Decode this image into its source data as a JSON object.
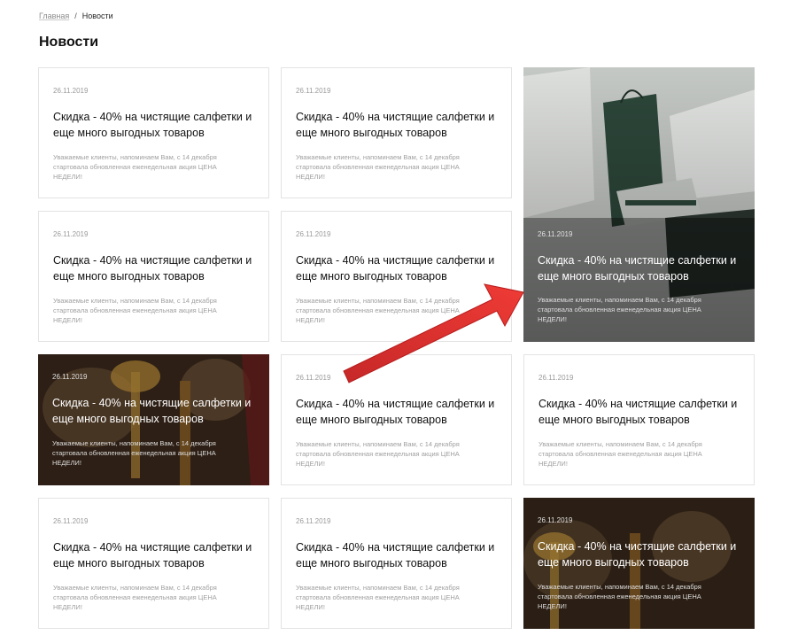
{
  "breadcrumb": {
    "home": "Главная",
    "separator": "/",
    "current": "Новости"
  },
  "page": {
    "title": "Новости"
  },
  "news": [
    {
      "date": "26.11.2019",
      "title": "Скидка - 40% на чистящие салфетки  и еще много выгодных товаров",
      "desc": "Уважаемые клиенты, напоминаем Вам, с 14 декабря стартовала обновленная еженедельная акция ЦЕНА НЕДЕЛИ!"
    },
    {
      "date": "26.11.2019",
      "title": "Скидка - 40% на чистящие салфетки  и еще много выгодных товаров",
      "desc": "Уважаемые клиенты, напоминаем Вам, с 14 декабря стартовала обновленная еженедельная акция ЦЕНА НЕДЕЛИ!"
    },
    {
      "date": "26.11.2019",
      "title": "Скидка - 40% на чистящие салфетки  и еще много выгодных товаров",
      "desc": "Уважаемые клиенты, напоминаем Вам, с 14 декабря стартовала обновленная еженедельная акция ЦЕНА НЕДЕЛИ!"
    },
    {
      "date": "26.11.2019",
      "title": "Скидка - 40% на чистящие салфетки  и еще много выгодных товаров",
      "desc": "Уважаемые клиенты, напоминаем Вам, с 14 декабря стартовала обновленная еженедельная акция ЦЕНА НЕДЕЛИ!"
    },
    {
      "date": "26.11.2019",
      "title": "Скидка - 40% на чистящие салфетки  и еще много выгодных товаров",
      "desc": "Уважаемые клиенты, напоминаем Вам, с 14 декабря стартовала обновленная еженедельная акция ЦЕНА НЕДЕЛИ!"
    },
    {
      "date": "26.11.2019",
      "title": "Скидка - 40% на чистящие салфетки  и еще много выгодных товаров",
      "desc": "Уважаемые клиенты, напоминаем Вам, с 14 декабря стартовала обновленная еженедельная акция ЦЕНА НЕДЕЛИ!"
    },
    {
      "date": "26.11.2019",
      "title": "Скидка - 40% на чистящие салфетки  и еще много выгодных товаров",
      "desc": "Уважаемые клиенты, напоминаем Вам, с 14 декабря стартовала обновленная еженедельная акция ЦЕНА НЕДЕЛИ!"
    },
    {
      "date": "26.11.2019",
      "title": "Скидка - 40% на чистящие салфетки  и еще много выгодных товаров",
      "desc": "Уважаемые клиенты, напоминаем Вам, с 14 декабря стартовала обновленная еженедельная акция ЦЕНА НЕДЕЛИ!"
    },
    {
      "date": "26.11.2019",
      "title": "Скидка - 40% на чистящие салфетки  и еще много выгодных товаров",
      "desc": "Уважаемые клиенты, напоминаем Вам, с 14 декабря стартовала обновленная еженедельная акция ЦЕНА НЕДЕЛИ!"
    },
    {
      "date": "26.11.2019",
      "title": "Скидка - 40% на чистящие салфетки  и еще много выгодных товаров",
      "desc": "Уважаемые клиенты, напоминаем Вам, с 14 декабря стартовала обновленная еженедельная акция ЦЕНА НЕДЕЛИ!"
    },
    {
      "date": "26.11.2019",
      "title": "Скидка - 40% на чистящие салфетки  и еще много выгодных товаров",
      "desc": "Уважаемые клиенты, напоминаем Вам, с 14 декабря стартовала обновленная еженедельная акция ЦЕНА НЕДЕЛИ!"
    }
  ],
  "colors": {
    "annotation_arrow": "#e53935",
    "card_border": "#e3e3e3"
  },
  "icons": {
    "annotation": "arrow-icon"
  }
}
